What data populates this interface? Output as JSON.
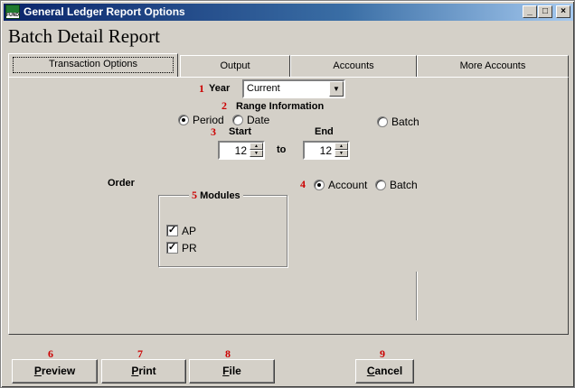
{
  "window": {
    "title": "General Ledger Report Options",
    "icon_text": "FUND",
    "controls": {
      "minimize": "_",
      "maximize": "□",
      "close": "×"
    }
  },
  "heading": "Batch Detail Report",
  "tabs": [
    {
      "label": "Transaction Options",
      "active": true
    },
    {
      "label": "Output",
      "active": false
    },
    {
      "label": "Accounts",
      "active": false
    },
    {
      "label": "More Accounts",
      "active": false
    }
  ],
  "step_numbers": [
    "1",
    "2",
    "3",
    "4",
    "5",
    "6",
    "7",
    "8",
    "9"
  ],
  "year": {
    "label": "Year",
    "value": "Current"
  },
  "range": {
    "label": "Range Information",
    "options": [
      {
        "label": "Period",
        "selected": true
      },
      {
        "label": "Date",
        "selected": false
      },
      {
        "label": "Batch",
        "selected": false
      }
    ],
    "start_label": "Start",
    "end_label": "End",
    "to_label": "to",
    "start_value": "12",
    "end_value": "12"
  },
  "order": {
    "label": "Order",
    "options": [
      {
        "label": "Account",
        "selected": true
      },
      {
        "label": "Batch",
        "selected": false
      }
    ]
  },
  "modules": {
    "label": "Modules",
    "items": [
      {
        "label": "AP",
        "checked": true,
        "mark": "✓"
      },
      {
        "label": "PR",
        "checked": true,
        "mark": "✓"
      }
    ]
  },
  "buttons": {
    "preview": {
      "first": "P",
      "rest": "review"
    },
    "print": {
      "first": "P",
      "rest": "rint"
    },
    "file": {
      "first": "F",
      "rest": "ile"
    },
    "cancel": {
      "first": "C",
      "rest": "ancel"
    }
  }
}
